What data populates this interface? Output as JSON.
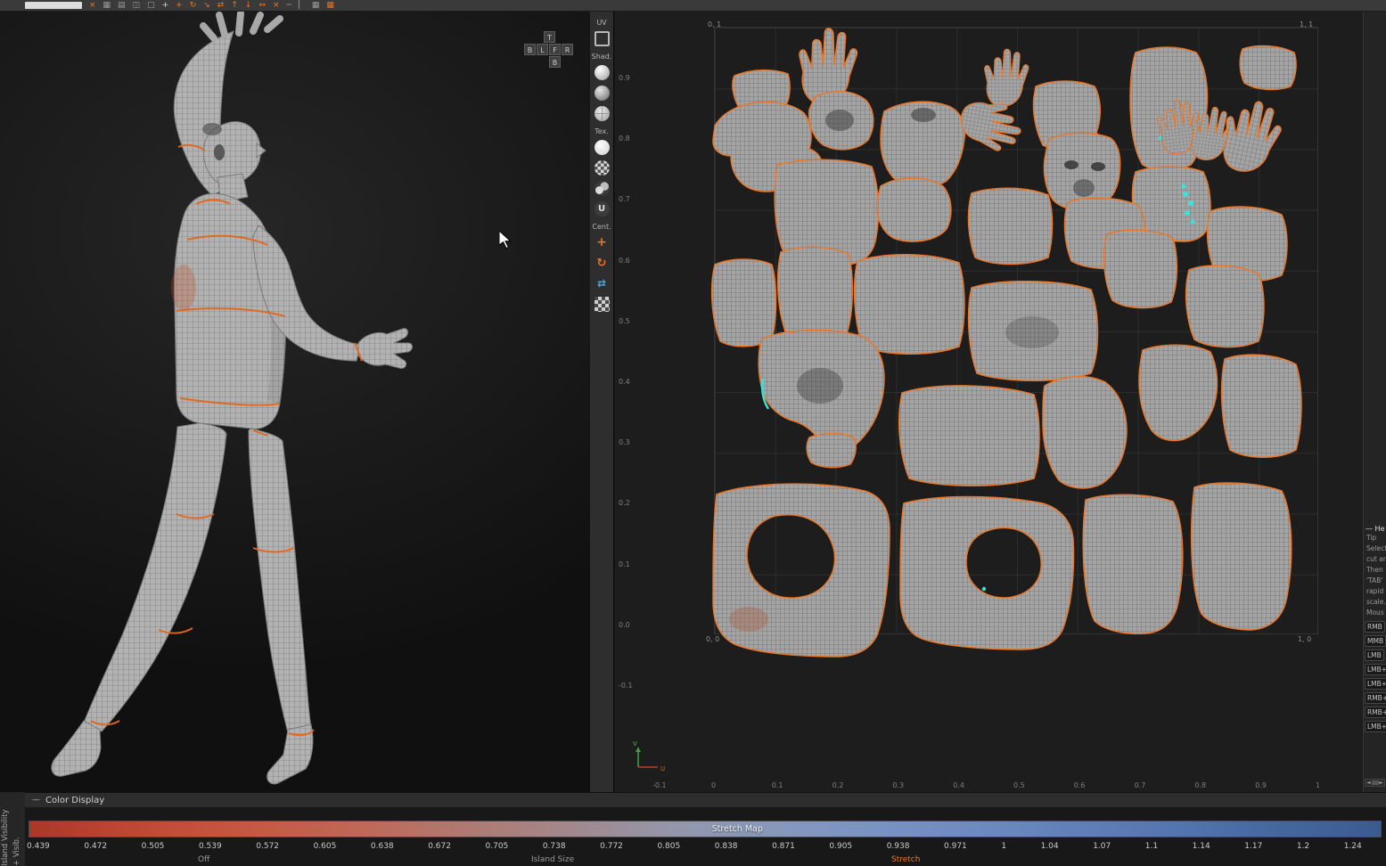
{
  "top_toolbar": {
    "icons": [
      {
        "kind": "button",
        "name": "toolbar-button"
      },
      {
        "glyph": "×",
        "color": "#e8732a",
        "name": "delete-icon"
      },
      {
        "glyph": "▦",
        "color": "#9b9b9b",
        "name": "grid-icon"
      },
      {
        "glyph": "▤",
        "color": "#9b9b9b",
        "name": "rows-icon"
      },
      {
        "glyph": "◫",
        "color": "#9b9b9b",
        "name": "split-view-icon"
      },
      {
        "glyph": "□",
        "color": "#9b9b9b",
        "name": "marquee-select-icon"
      },
      {
        "glyph": "+",
        "color": "#d0d0d0",
        "name": "pan-icon"
      },
      {
        "glyph": "+",
        "color": "#e8732a",
        "name": "move-icon"
      },
      {
        "glyph": "↻",
        "color": "#e8732a",
        "name": "rotate-icon"
      },
      {
        "glyph": "↘",
        "color": "#e8732a",
        "name": "scale-icon"
      },
      {
        "glyph": "⇄",
        "color": "#e8732a",
        "name": "mirror-icon"
      },
      {
        "glyph": "↑",
        "color": "#e8732a",
        "name": "align-top-icon"
      },
      {
        "glyph": "↓",
        "color": "#e8732a",
        "name": "align-bottom-icon"
      },
      {
        "glyph": "↔",
        "color": "#e8732a",
        "name": "distribute-icon"
      },
      {
        "glyph": "×",
        "color": "#e8732a",
        "name": "clear-icon"
      },
      {
        "glyph": "─",
        "color": "#9b9b9b",
        "name": "minus-icon"
      },
      {
        "glyph": "▏",
        "color": "#9b9b9b",
        "name": "divider-icon"
      },
      {
        "glyph": "▦",
        "color": "#9b9b9b",
        "name": "snap-grid-icon"
      },
      {
        "glyph": "▦",
        "color": "#e8732a",
        "name": "pack-icon"
      }
    ]
  },
  "view_cube": {
    "labels": [
      "T",
      "B",
      "L",
      "F",
      "R",
      "B"
    ]
  },
  "mid_toolbar": {
    "items": [
      {
        "type": "label",
        "text": "UV"
      },
      {
        "type": "icon",
        "kind": "uv-frame",
        "name": "uv-frame-icon"
      },
      {
        "type": "label",
        "text": "Shad."
      },
      {
        "type": "icon",
        "kind": "sphere-white",
        "name": "shaded-white-sphere-icon"
      },
      {
        "type": "icon",
        "kind": "sphere-gray",
        "name": "shaded-gray-sphere-icon"
      },
      {
        "type": "icon",
        "kind": "globe",
        "name": "wire-sphere-icon"
      },
      {
        "type": "label",
        "text": "Tex."
      },
      {
        "type": "icon",
        "kind": "circle-plain",
        "name": "texture-plain-icon"
      },
      {
        "type": "icon",
        "kind": "checker-circle",
        "name": "texture-checker-icon"
      },
      {
        "type": "icon",
        "kind": "spheres-mini",
        "name": "texture-spheres-icon"
      },
      {
        "type": "icon",
        "kind": "letter-u",
        "glyph": "U",
        "name": "texture-uv-icon"
      },
      {
        "type": "label",
        "text": "Cent."
      },
      {
        "type": "icon",
        "kind": "move-gizmo",
        "glyph": "+",
        "name": "center-move-icon"
      },
      {
        "type": "icon",
        "kind": "rotate-gizmo",
        "glyph": "↻",
        "name": "center-rotate-icon"
      },
      {
        "type": "icon",
        "kind": "sync-gizmo",
        "glyph": "⇄",
        "name": "sync-views-icon"
      },
      {
        "type": "icon",
        "kind": "checker-grid",
        "name": "checker-grid-icon"
      }
    ]
  },
  "uv_editor": {
    "corners": {
      "tl": "0, 1",
      "tr": "1, 1",
      "bl": "0, 0",
      "br": "1, 0"
    },
    "y_ticks": [
      "0.9",
      "0.8",
      "0.7",
      "0.6",
      "0.5",
      "0.4",
      "0.3",
      "0.2",
      "0.1",
      "0.0",
      "-0.1"
    ],
    "x_ticks": [
      "-0.1",
      "0",
      "0.1",
      "0.2",
      "0.3",
      "0.4",
      "0.5",
      "0.6",
      "0.7",
      "0.8",
      "0.9",
      "1"
    ],
    "axis": {
      "u": "U",
      "v": "V"
    }
  },
  "help_panel": {
    "dash": "—",
    "header": "He",
    "lines": [
      {
        "text": "Tip"
      },
      {
        "text": "Select"
      },
      {
        "text": "cut an"
      },
      {
        "text": "Then "
      },
      {
        "text": "'TAB'"
      },
      {
        "text": "rapid"
      },
      {
        "text": "scale."
      },
      {
        "text": "Mous"
      },
      {
        "text": "RMB",
        "chip": true
      },
      {
        "text": "MMB",
        "chip": true
      },
      {
        "text": "LMB",
        "chip": true
      },
      {
        "text": "LMB+",
        "chip": true
      },
      {
        "text": "LMB+",
        "chip": true
      },
      {
        "text": "RMB+",
        "chip": true
      },
      {
        "text": "RMB+",
        "chip": true
      },
      {
        "text": "LMB+",
        "chip": true
      }
    ]
  },
  "bottom": {
    "collapse_dash": "—",
    "color_display": "Color Display",
    "stretch_label": "Stretch Map",
    "ticks": [
      "0.439",
      "0.472",
      "0.505",
      "0.539",
      "0.572",
      "0.605",
      "0.638",
      "0.672",
      "0.705",
      "0.738",
      "0.772",
      "0.805",
      "0.838",
      "0.871",
      "0.905",
      "0.938",
      "0.971",
      "1",
      "1.04",
      "1.07",
      "1.1",
      "1.14",
      "1.17",
      "1.2",
      "1.24"
    ],
    "partials": [
      {
        "text": "Off",
        "x": 222
      },
      {
        "text": "Island Size",
        "x": 596
      },
      {
        "text": "Stretch",
        "x": 1000,
        "color": "#e8772a"
      }
    ]
  },
  "side_labels": {
    "island_visibility": "Island Visibility",
    "visib": "+ Visib."
  },
  "colors": {
    "accent_orange": "#e8732a",
    "seam_orange": "#e2671d",
    "selection_cyan": "#39e3da"
  }
}
